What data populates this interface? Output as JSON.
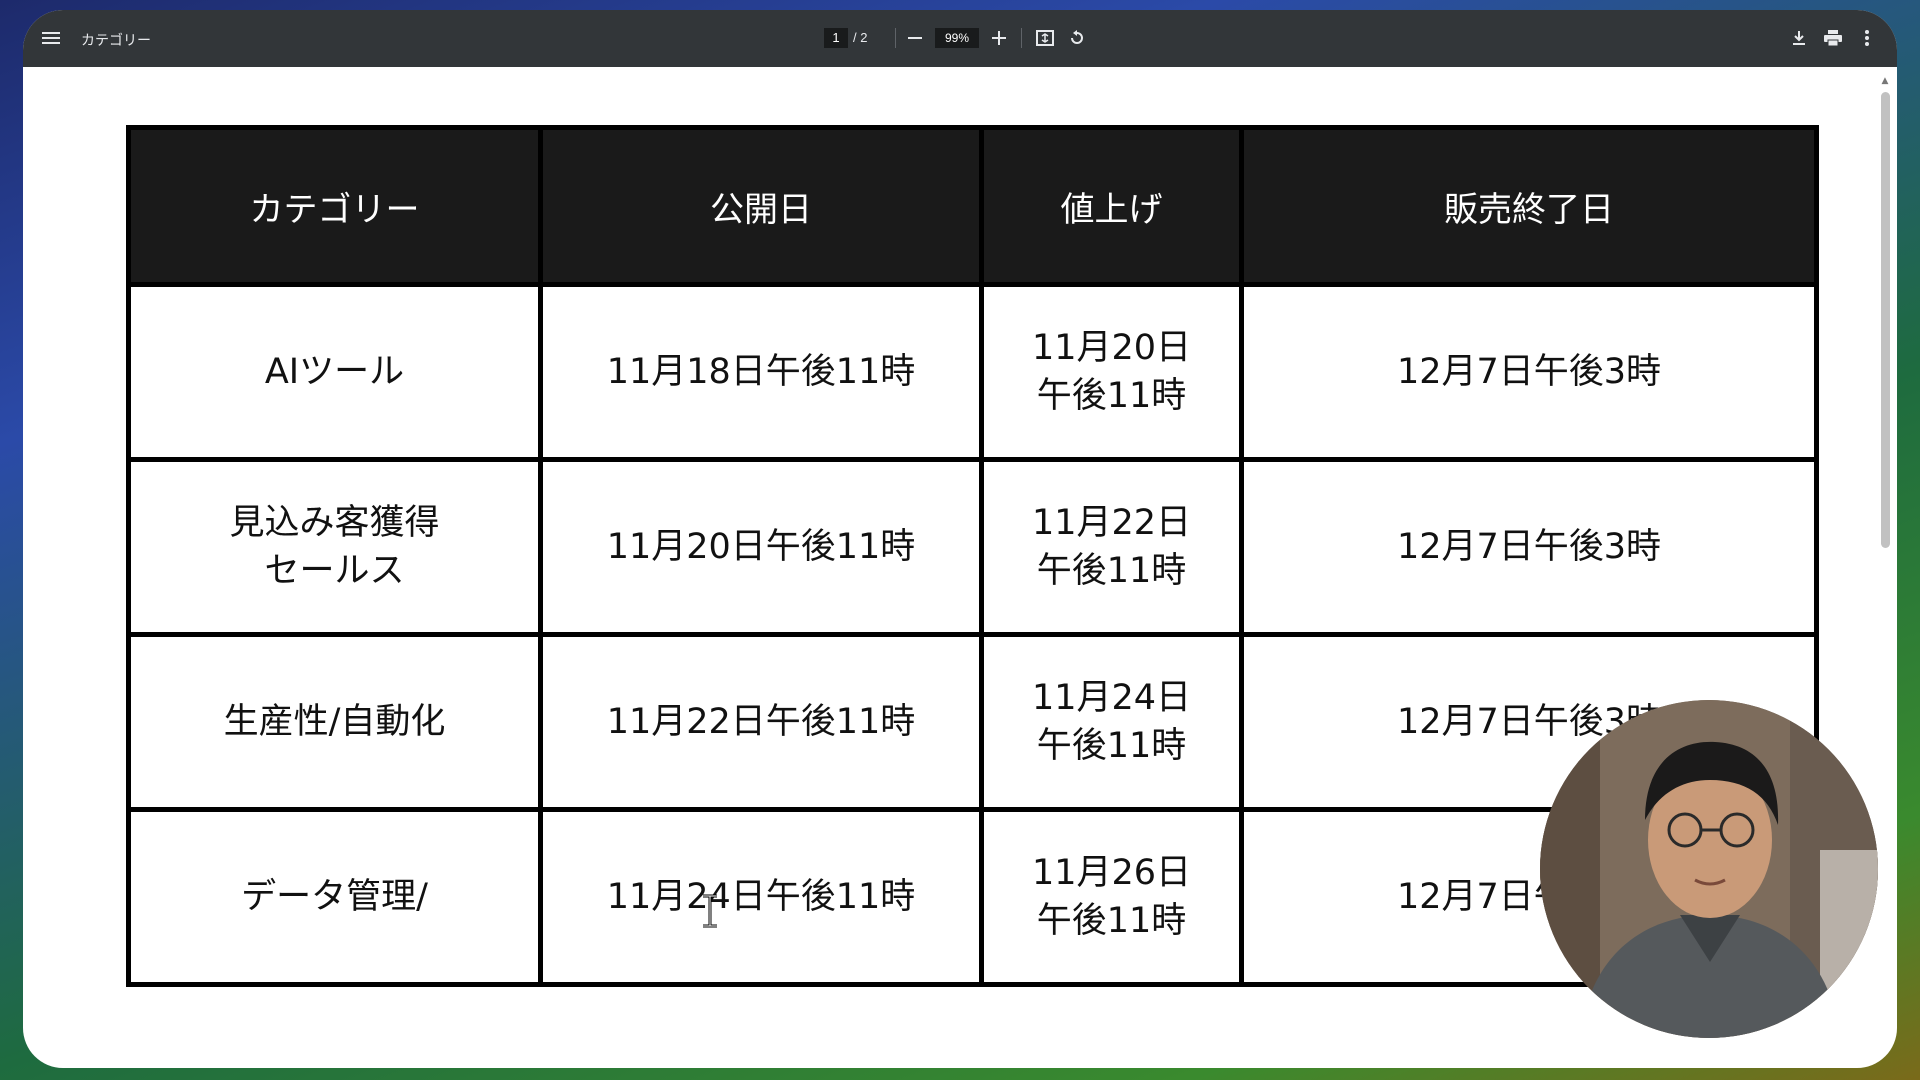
{
  "toolbar": {
    "title": "カテゴリー",
    "page_current": "1",
    "page_total": "/ 2",
    "zoom": "99%",
    "icons": [
      "menu-icon",
      "zoom-out-icon",
      "zoom-in-icon",
      "fit-page-icon",
      "rotate-icon",
      "download-icon",
      "print-icon",
      "more-options-icon"
    ]
  },
  "table": {
    "headers": [
      "カテゴリー",
      "公開日",
      "値上げ",
      "販売終了日"
    ],
    "rows": [
      {
        "category": [
          "AIツール"
        ],
        "release": "11月18日午後11時",
        "price_up": [
          "11月20日",
          "午後11時"
        ],
        "end": "12月7日午後3時"
      },
      {
        "category": [
          "見込み客獲得",
          "セールス"
        ],
        "release": "11月20日午後11時",
        "price_up": [
          "11月22日",
          "午後11時"
        ],
        "end": "12月7日午後3時"
      },
      {
        "category": [
          "生産性/自動化"
        ],
        "release": "11月22日午後11時",
        "price_up": [
          "11月24日",
          "午後11時"
        ],
        "end": "12月7日午後3時"
      },
      {
        "category": [
          "データ管理/"
        ],
        "release": "11月24日午後11時",
        "price_up": [
          "11月26日",
          "午後11時"
        ],
        "end": "12月7日午後3時"
      }
    ]
  },
  "colors": {
    "toolbar_bg": "#323639",
    "header_bg": "#1a1a1a",
    "border": "#000000"
  }
}
